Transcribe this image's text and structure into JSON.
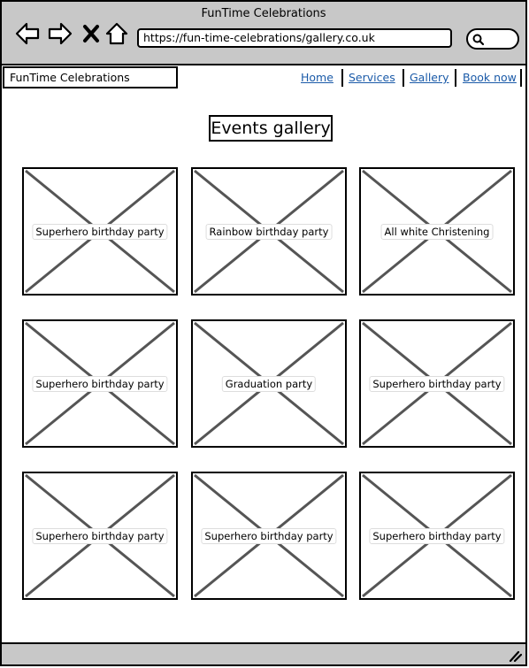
{
  "window": {
    "title": "FunTime Celebrations"
  },
  "browser": {
    "url": "https://fun-time-celebrations/gallery.co.uk",
    "buttons": {
      "back": "back-arrow-icon",
      "forward": "forward-arrow-icon",
      "stop": "close-icon",
      "home": "home-icon"
    }
  },
  "site": {
    "brand": "FunTime Celebrations",
    "nav": [
      "Home",
      "Services",
      "Gallery",
      "Book now"
    ]
  },
  "main": {
    "title": "Events gallery",
    "tiles": [
      "Superhero birthday party",
      "Rainbow birthday party",
      "All white Christening",
      "Superhero birthday party",
      "Graduation party",
      "Superhero birthday party",
      "Superhero birthday party",
      "Superhero birthday party",
      "Superhero birthday party"
    ]
  },
  "colors": {
    "chrome": "#c8c8c8",
    "link": "#1a5aa8",
    "placeholder_stroke": "#555555"
  }
}
